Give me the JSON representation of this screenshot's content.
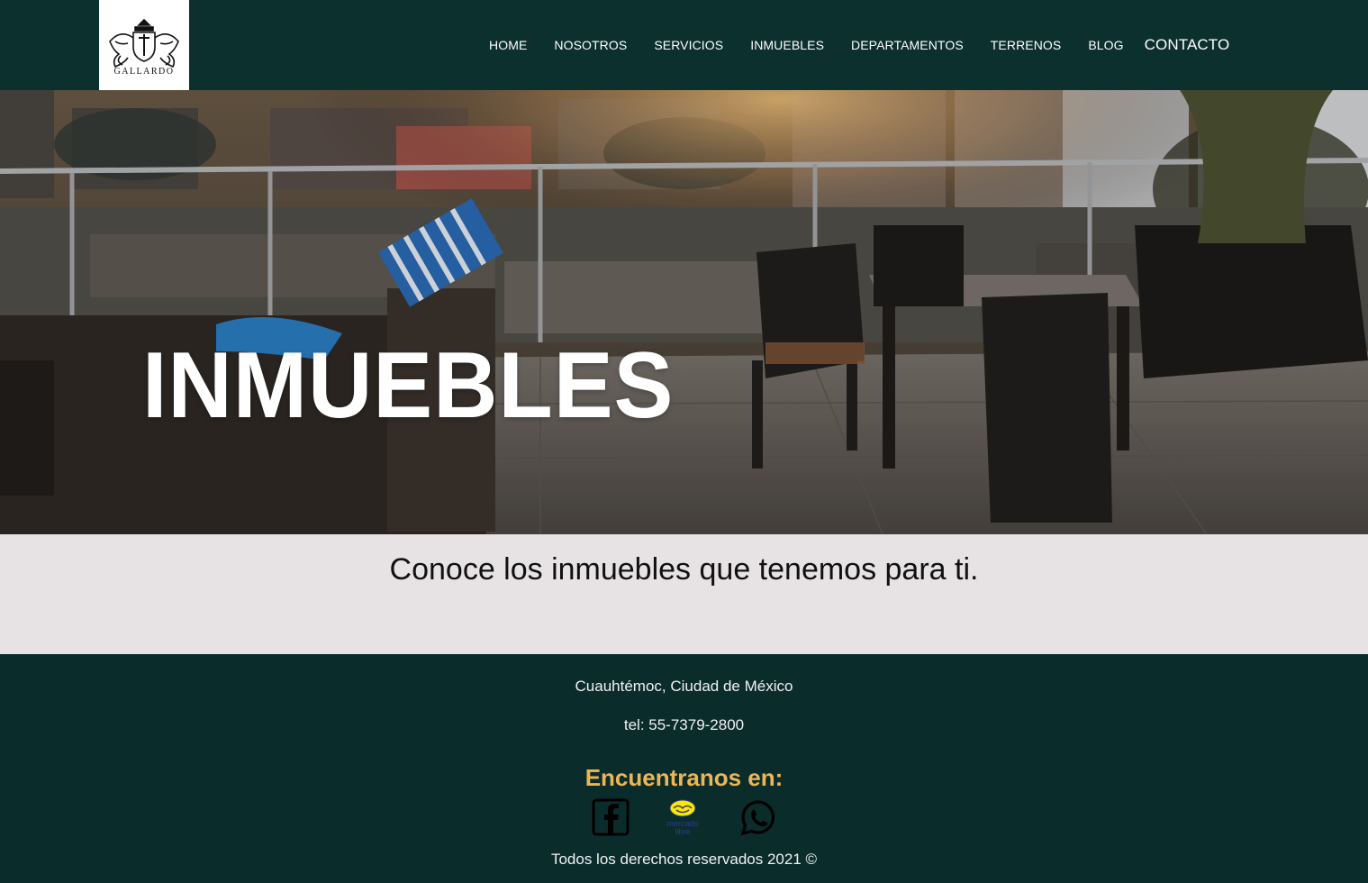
{
  "brand": {
    "logo_text": "GALLARDO"
  },
  "nav": {
    "items": [
      {
        "label": "HOME"
      },
      {
        "label": "NOSOTROS"
      },
      {
        "label": "SERVICIOS"
      },
      {
        "label": "INMUEBLES"
      },
      {
        "label": "DEPARTAMENTOS"
      },
      {
        "label": "TERRENOS"
      },
      {
        "label": "BLOG"
      },
      {
        "label": "CONTACTO"
      }
    ]
  },
  "hero": {
    "title": "INMUEBLES"
  },
  "intro": {
    "text": "Conoce los inmuebles que tenemos para ti."
  },
  "footer": {
    "address": "Cuauhtémoc, Ciudad de México",
    "tel": "tel: 55-7379-2800",
    "find_us": "Encuentranos en:",
    "socials": [
      {
        "icon": "facebook-icon"
      },
      {
        "icon": "mercado-libre-icon",
        "label_line1": "mercado",
        "label_line2": "libre"
      },
      {
        "icon": "whatsapp-icon"
      }
    ],
    "copyright": "Todos los derechos reservados 2021 ©"
  },
  "colors": {
    "header_bg": "#0b302e",
    "footer_bg": "#0a2d2b",
    "intro_bg": "#e7e3e4",
    "accent": "#eeb554"
  }
}
